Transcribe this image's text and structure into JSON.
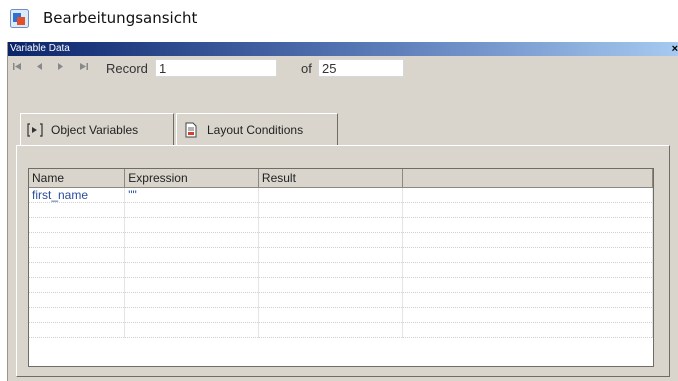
{
  "app": {
    "title": "Bearbeitungsansicht"
  },
  "window": {
    "title": "Variable Data",
    "close": "×"
  },
  "navigator": {
    "first": "⏮",
    "prev": "◀",
    "next": "▶",
    "last": "⏭",
    "record_label": "Record",
    "record_value": "1",
    "of_label": "of",
    "total_value": "25"
  },
  "tabs": [
    {
      "label": "Object Variables",
      "icon": "variables-icon",
      "selected": true
    },
    {
      "label": "Layout Conditions",
      "icon": "document-icon",
      "selected": false
    }
  ],
  "grid": {
    "columns": [
      "Name",
      "Expression",
      "Result",
      ""
    ],
    "rows": [
      [
        "first_name",
        "\"\"",
        "",
        ""
      ],
      [
        "",
        "",
        "",
        ""
      ],
      [
        "",
        "",
        "",
        ""
      ],
      [
        "",
        "",
        "",
        ""
      ],
      [
        "",
        "",
        "",
        ""
      ],
      [
        "",
        "",
        "",
        ""
      ],
      [
        "",
        "",
        "",
        ""
      ],
      [
        "",
        "",
        "",
        ""
      ],
      [
        "",
        "",
        "",
        ""
      ],
      [
        "",
        "",
        "",
        ""
      ]
    ]
  },
  "colors": {
    "accent": "#0a246a",
    "window_bg": "#d9d5cc",
    "link_text": "#2a4d9c"
  }
}
